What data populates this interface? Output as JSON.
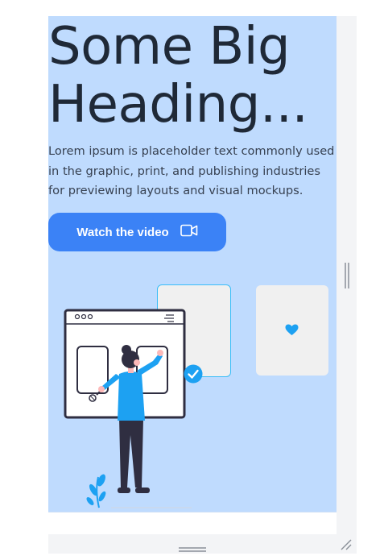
{
  "hero": {
    "heading": "Some Big Heading...",
    "paragraph": "Lorem ipsum is placeholder text commonly used in the graphic, print, and publishing industries for previewing layouts and visual mockups.",
    "cta_label": "Watch the video",
    "cta_icon": "video-camera-icon"
  },
  "colors": {
    "background": "#bfdbfe",
    "button": "#3b82f6",
    "heading": "#1f2937",
    "accent": "#1da1f2"
  },
  "icons": {
    "heart": "heart-icon",
    "check": "check-circle-icon",
    "resize_handle": "resize-handle-icon",
    "grip_vertical": "vertical-grip-icon",
    "grip_horizontal": "horizontal-grip-icon"
  }
}
